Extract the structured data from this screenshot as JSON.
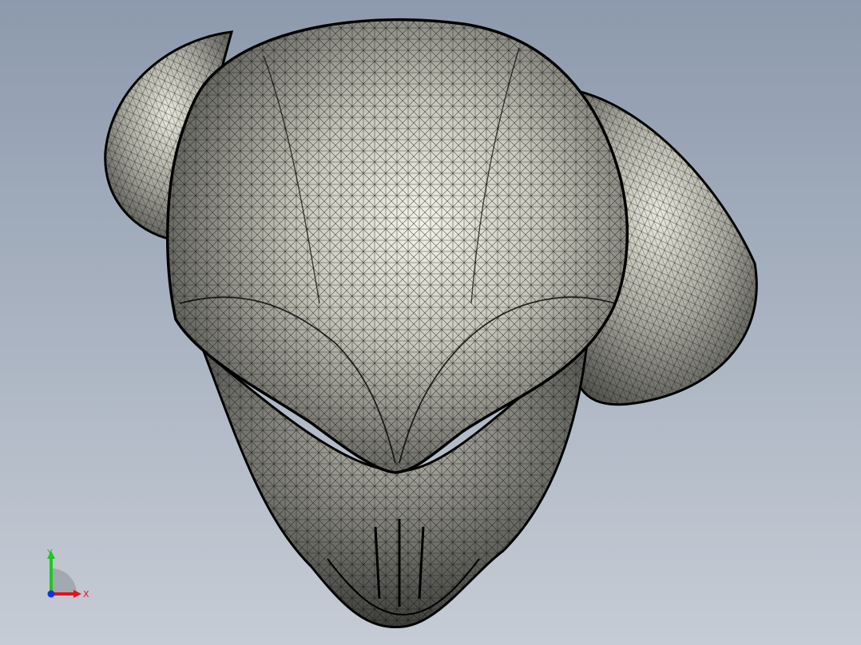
{
  "viewport": {
    "background_top": "#8d9aad",
    "background_bottom": "#c6ccd5",
    "model_kind": "mesh-wireframe-shaded",
    "model_color": "#d8d8cc",
    "edge_color": "#111111"
  },
  "triad": {
    "x_label": "X",
    "y_label": "Y",
    "x_color": "#e0141c",
    "y_color": "#1ec81e",
    "z_color": "#1432e6"
  }
}
